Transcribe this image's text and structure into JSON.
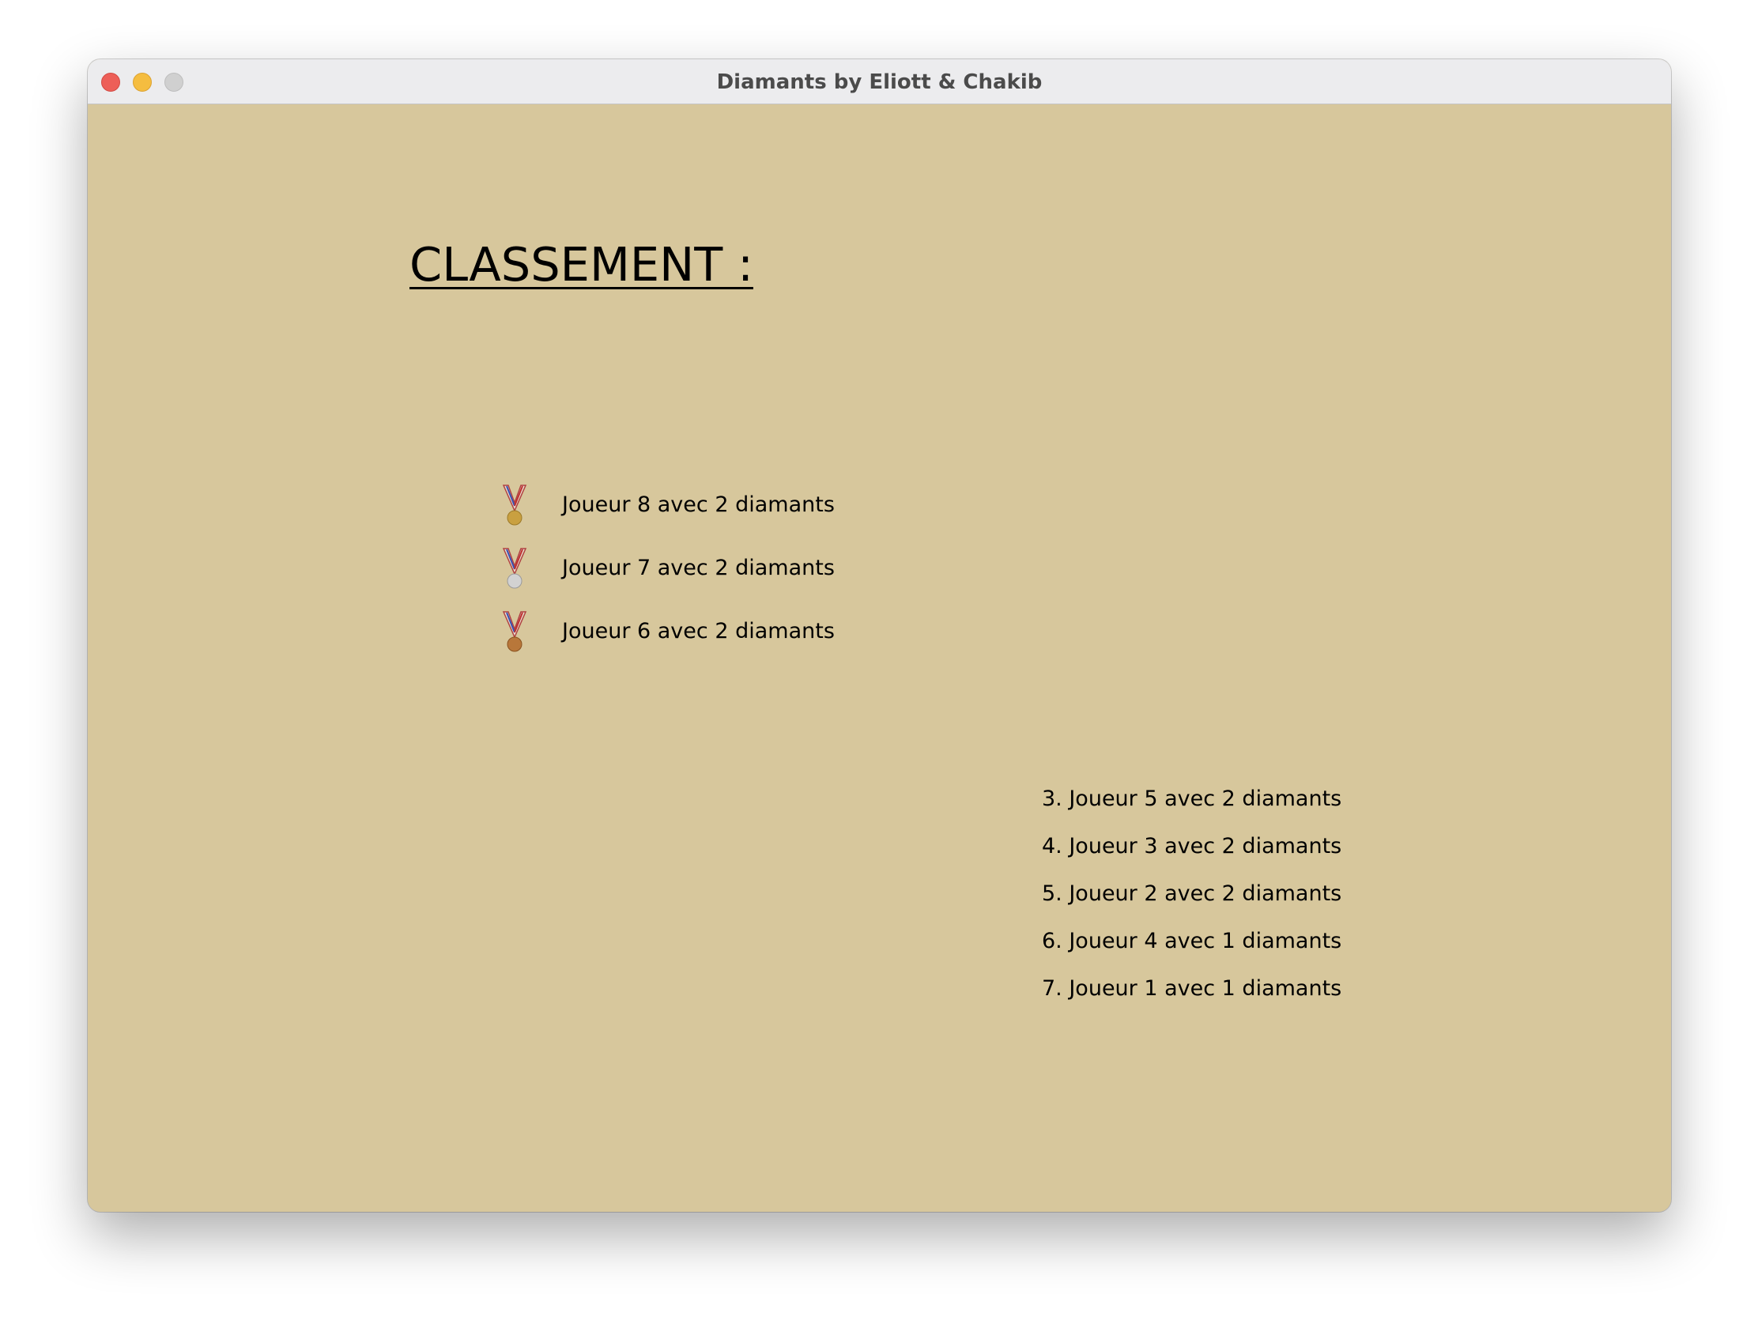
{
  "window": {
    "title": "Diamants by Eliott & Chakib"
  },
  "heading": "CLASSEMENT :",
  "podium": [
    {
      "medal": "gold-medal-icon",
      "medal_color": "#c9a040",
      "text": "Joueur 8 avec 2 diamants"
    },
    {
      "medal": "silver-medal-icon",
      "medal_color": "#c8c8c8",
      "text": "Joueur 7 avec 2 diamants"
    },
    {
      "medal": "bronze-medal-icon",
      "medal_color": "#b8773a",
      "text": "Joueur 6 avec 2 diamants"
    }
  ],
  "ranking": [
    "3. Joueur 5 avec 2 diamants",
    "4. Joueur 3 avec 2 diamants",
    "5. Joueur 2 avec 2 diamants",
    "6. Joueur 4 avec 1 diamants",
    "7. Joueur 1 avec 1 diamants"
  ],
  "colors": {
    "background": "#d7c79c",
    "close": "#ed5f58",
    "minimize": "#f5bd40",
    "maximize": "#d0d0d0"
  }
}
